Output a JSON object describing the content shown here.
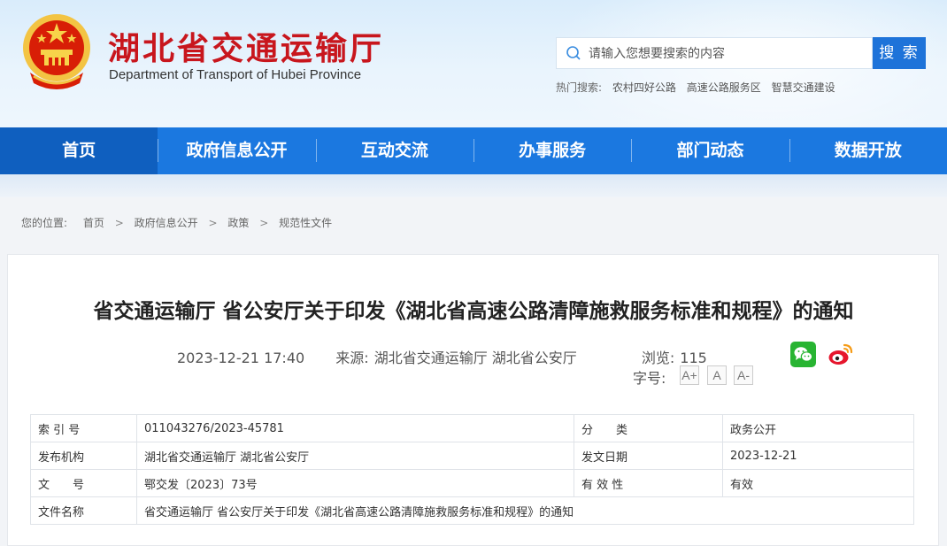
{
  "header": {
    "title_cn": "湖北省交通运输厅",
    "title_en": "Department of Transport of Hubei Province",
    "search": {
      "placeholder": "请输入您想要搜索的内容",
      "button": "搜 索"
    },
    "hot_search": {
      "label": "热门搜索:",
      "items": [
        "农村四好公路",
        "高速公路服务区",
        "智慧交通建设"
      ]
    }
  },
  "nav": {
    "items": [
      "首页",
      "政府信息公开",
      "互动交流",
      "办事服务",
      "部门动态",
      "数据开放"
    ],
    "active_index": 0
  },
  "breadcrumb": {
    "label": "您的位置:",
    "items": [
      "首页",
      "政府信息公开",
      "政策",
      "规范性文件"
    ]
  },
  "article": {
    "title": "省交通运输厅 省公安厅关于印发《湖北省高速公路清障施救服务标准和规程》的通知",
    "datetime": "2023-12-21 17:40",
    "source_label": "来源:",
    "source": "湖北省交通运输厅 湖北省公安厅",
    "views_label": "浏览:",
    "views": "115",
    "font_size_label": "字号:",
    "font_buttons": [
      "A+",
      "A",
      "A-"
    ],
    "share": [
      "wechat-icon",
      "weibo-icon"
    ]
  },
  "info_table": {
    "rows": [
      [
        "索 引 号",
        "011043276/2023-45781",
        "分　　类",
        "政务公开"
      ],
      [
        "发布机构",
        "湖北省交通运输厅 湖北省公安厅",
        "发文日期",
        "2023-12-21"
      ],
      [
        "文　　号",
        "鄂交发〔2023〕73号",
        "有 效 性",
        "有效"
      ],
      [
        "文件名称",
        "省交通运输厅 省公安厅关于印发《湖北省高速公路清障施救服务标准和规程》的通知"
      ]
    ]
  },
  "colors": {
    "brand_red": "#c8161d",
    "nav_blue": "#1b78e0",
    "search_blue": "#1e73d9"
  }
}
